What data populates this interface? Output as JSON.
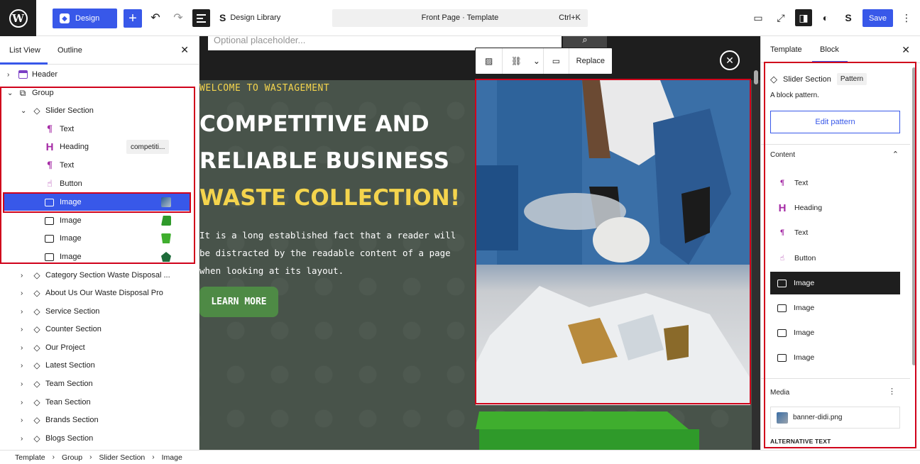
{
  "topbar": {
    "design_label": "Design",
    "design_library_label": "Design Library",
    "command_title": "Front Page · Template",
    "command_shortcut": "Ctrl+K",
    "save_label": "Save"
  },
  "left_panel": {
    "tab_list_view": "List View",
    "tab_outline": "Outline",
    "items": [
      {
        "label": "Header"
      },
      {
        "label": "Group"
      },
      {
        "label": "Slider Section"
      },
      {
        "label": "Text"
      },
      {
        "label": "Heading",
        "badge": "competiti..."
      },
      {
        "label": "Text"
      },
      {
        "label": "Button"
      },
      {
        "label": "Image"
      },
      {
        "label": "Image"
      },
      {
        "label": "Image"
      },
      {
        "label": "Image"
      },
      {
        "label": "Category Section Waste Disposal ..."
      },
      {
        "label": "About Us Our Waste Disposal Pro"
      },
      {
        "label": "Service Section"
      },
      {
        "label": "Counter Section"
      },
      {
        "label": "Our Project"
      },
      {
        "label": "Latest Section"
      },
      {
        "label": "Team Section"
      },
      {
        "label": "Tean Section"
      },
      {
        "label": "Brands Section"
      },
      {
        "label": "Blogs Section"
      }
    ]
  },
  "canvas": {
    "search_placeholder": "Optional placeholder...",
    "welcome": "WELCOME TO WASTAGEMENT",
    "heading_line1": "COMPETITIVE AND",
    "heading_line2": "RELIABLE BUSINESS",
    "heading_line3": "WASTE COLLECTION!",
    "paragraph": "It is a long established fact that a reader will be distracted by the readable content of a page when looking at its layout.",
    "button": "LEARN MORE",
    "toolbar_replace": "Replace"
  },
  "right_panel": {
    "tab_template": "Template",
    "tab_block": "Block",
    "block_name": "Slider Section",
    "pattern_tag": "Pattern",
    "description": "A block pattern.",
    "edit_pattern": "Edit pattern",
    "content_title": "Content",
    "content_items": [
      {
        "label": "Text"
      },
      {
        "label": "Heading"
      },
      {
        "label": "Text"
      },
      {
        "label": "Button"
      },
      {
        "label": "Image"
      },
      {
        "label": "Image"
      },
      {
        "label": "Image"
      },
      {
        "label": "Image"
      }
    ],
    "media_title": "Media",
    "media_file": "banner-didi.png",
    "alt_text_label": "ALTERNATIVE TEXT"
  },
  "breadcrumb": [
    "Template",
    "Group",
    "Slider Section",
    "Image"
  ],
  "colors": {
    "accent": "#3858e9",
    "highlight_box": "#d0021b",
    "hero_yellow": "#f4d44d",
    "hero_green": "#4e8a45"
  }
}
